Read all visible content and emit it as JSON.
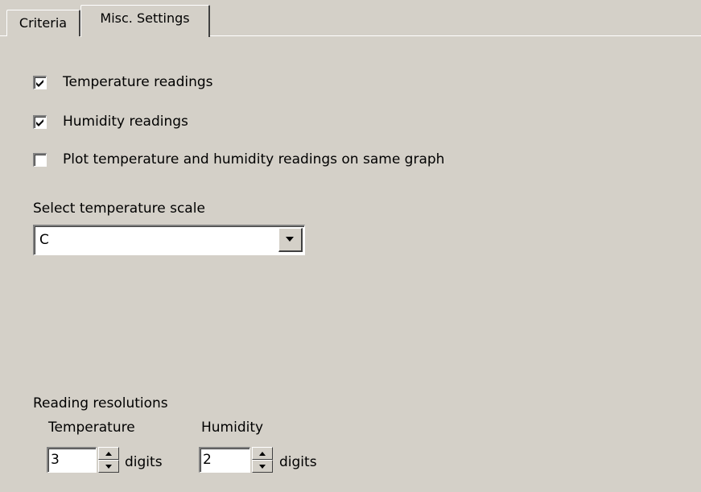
{
  "tabs": [
    {
      "label": "Criteria",
      "active": false
    },
    {
      "label": "Misc. Settings",
      "active": true
    }
  ],
  "checkboxes": [
    {
      "label": "Temperature readings",
      "checked": true
    },
    {
      "label": "Humidity readings",
      "checked": true
    },
    {
      "label": "Plot temperature and humidity readings on same graph",
      "checked": false
    }
  ],
  "scale": {
    "label": "Select temperature scale",
    "value": "C",
    "arrow_icon": "chevron-down-icon"
  },
  "resolutions": {
    "label": "Reading resolutions",
    "temperature": {
      "label": "Temperature",
      "value": "3",
      "unit": "digits"
    },
    "humidity": {
      "label": "Humidity",
      "value": "2",
      "unit": "digits"
    }
  },
  "colors": {
    "background": "#d4d0c8",
    "field": "#ffffff",
    "shadow": "#808080",
    "dark_shadow": "#404040",
    "highlight": "#ffffff"
  }
}
